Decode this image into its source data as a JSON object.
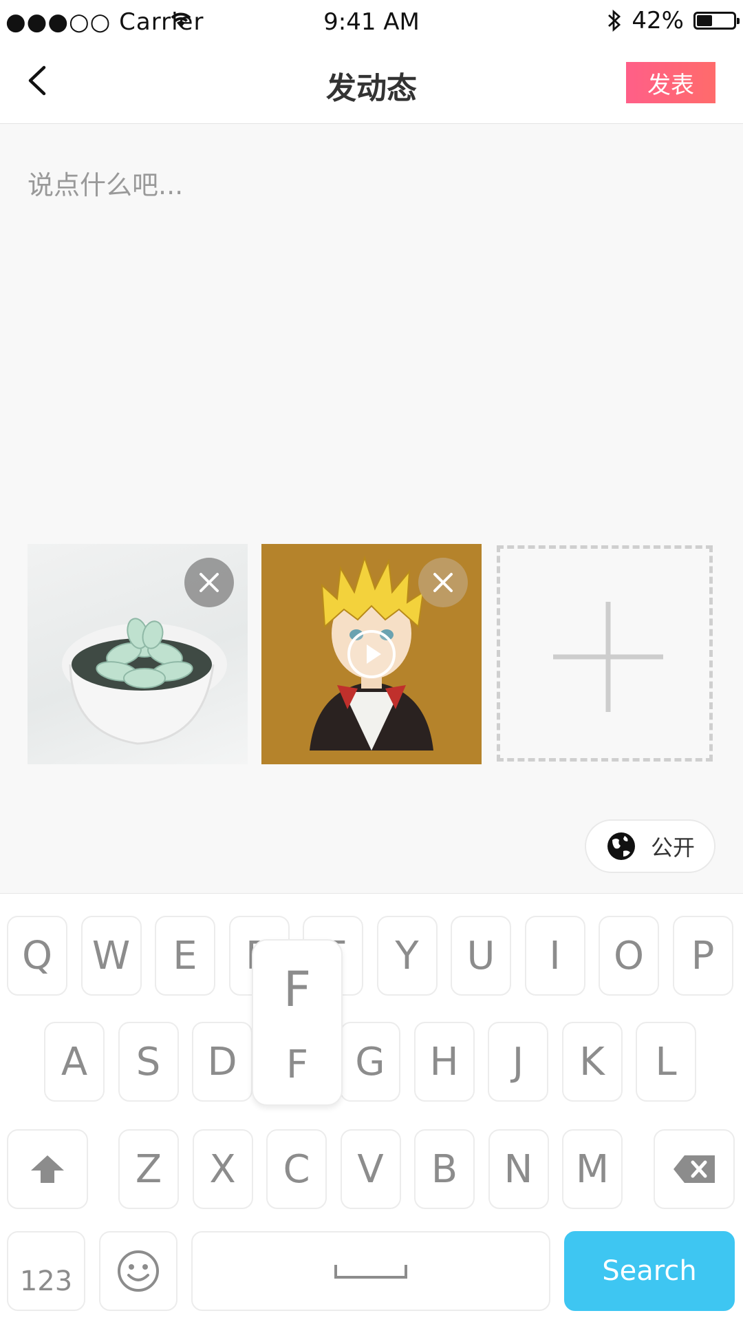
{
  "status_bar": {
    "carrier": "●●●○○ Carrier",
    "time": "9:41 AM",
    "battery": "42%",
    "battery_level": 0.42
  },
  "nav": {
    "title": "发动态",
    "publish_label": "发表"
  },
  "composer": {
    "placeholder": "说点什么吧..."
  },
  "visibility": {
    "label": "公开"
  },
  "keyboard": {
    "row1": [
      "Q",
      "W",
      "E",
      "R",
      "T",
      "Y",
      "U",
      "I",
      "O",
      "P"
    ],
    "row2": [
      "A",
      "S",
      "D",
      "F",
      "G",
      "H",
      "J",
      "K",
      "L"
    ],
    "row3": [
      "Z",
      "X",
      "C",
      "V",
      "B",
      "N",
      "M"
    ],
    "numbers_label": "123",
    "search_label": "Search",
    "popup_letter": "F"
  },
  "colors": {
    "accent_pink": "#ff5f88",
    "search_blue": "#3ec6f2",
    "key_text": "#8c8c8c"
  }
}
